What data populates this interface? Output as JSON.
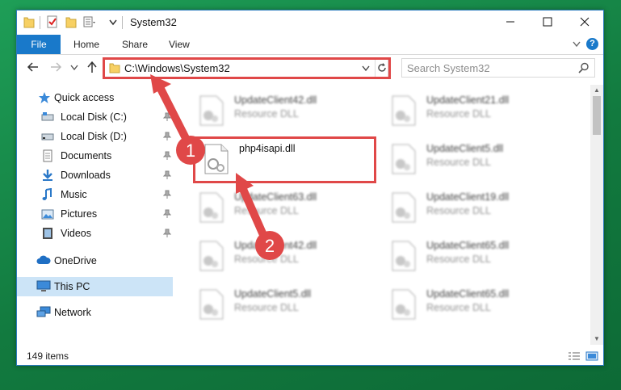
{
  "window": {
    "title": "System32"
  },
  "ribbon": {
    "tabs": [
      "File",
      "Home",
      "Share",
      "View"
    ],
    "help_label": "?"
  },
  "address": {
    "path": "C:\\Windows\\System32"
  },
  "search": {
    "placeholder": "Search System32"
  },
  "sidebar": {
    "items": [
      {
        "label": "Quick access",
        "icon": "star-icon",
        "pinned": false
      },
      {
        "label": "Local Disk (C:)",
        "icon": "drive-icon",
        "pinned": true
      },
      {
        "label": "Local Disk (D:)",
        "icon": "drive-icon",
        "pinned": true
      },
      {
        "label": "Documents",
        "icon": "documents-icon",
        "pinned": true
      },
      {
        "label": "Downloads",
        "icon": "download-icon",
        "pinned": true
      },
      {
        "label": "Music",
        "icon": "music-icon",
        "pinned": true
      },
      {
        "label": "Pictures",
        "icon": "pictures-icon",
        "pinned": true
      },
      {
        "label": "Videos",
        "icon": "videos-icon",
        "pinned": true
      },
      {
        "label": "OneDrive",
        "icon": "cloud-icon",
        "pinned": false
      },
      {
        "label": "This PC",
        "icon": "computer-icon",
        "pinned": false,
        "selected": true
      },
      {
        "label": "Network",
        "icon": "network-icon",
        "pinned": false
      }
    ]
  },
  "files": [
    {
      "name": "UpdateClient42.dll",
      "type": "Resource DLL"
    },
    {
      "name": "UpdateClient21.dll",
      "type": "Resource DLL"
    },
    {
      "name": "php4isapi.dll",
      "type": ""
    },
    {
      "name": "UpdateClient5.dll",
      "type": "Resource DLL"
    },
    {
      "name": "UpdateClient63.dll",
      "type": "Resource DLL"
    },
    {
      "name": "UpdateClient19.dll",
      "type": "Resource DLL"
    },
    {
      "name": "UpdateClient42.dll",
      "type": "Resource DLL"
    },
    {
      "name": "UpdateClient65.dll",
      "type": "Resource DLL"
    },
    {
      "name": "UpdateClient5.dll",
      "type": "Resource DLL"
    },
    {
      "name": "UpdateClient65.dll",
      "type": "Resource DLL"
    }
  ],
  "status": {
    "item_count": "149 items"
  },
  "annotations": [
    {
      "label": "1"
    },
    {
      "label": "2"
    }
  ],
  "colors": {
    "accent": "#1979ca",
    "highlight": "#e04848",
    "desktop": "#1e9e57"
  }
}
